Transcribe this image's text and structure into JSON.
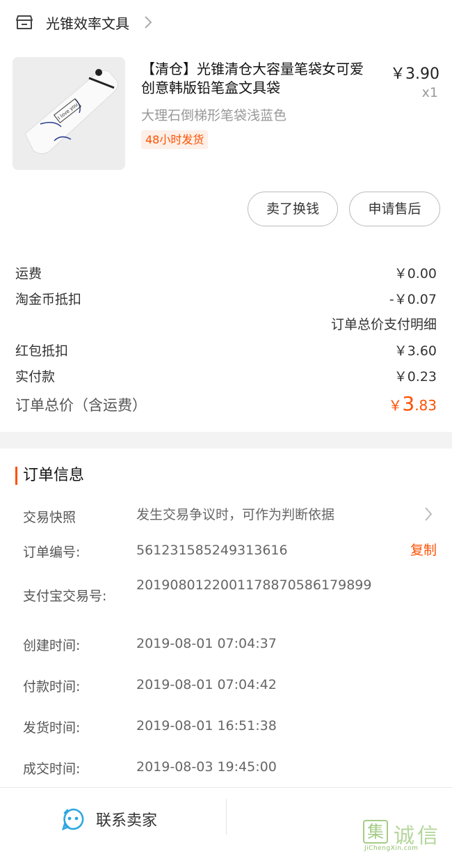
{
  "shop": {
    "name": "光锥效率文具"
  },
  "product": {
    "title": "【清仓】光锥清仓大容量笔袋女可爱创意韩版铅笔盒文具袋",
    "price": "￥3.90",
    "quantity": "x1",
    "sku": "大理石倒梯形笔袋浅蓝色",
    "ship_tag": "48小时发货",
    "image_text": "I love you"
  },
  "actions": {
    "sell_button": "卖了换钱",
    "after_sale_button": "申请售后"
  },
  "fees": {
    "shipping_label": "运费",
    "shipping_value": "￥0.00",
    "coin_label": "淘金币抵扣",
    "coin_value": "-￥0.07",
    "detail_link": "订单总价支付明细",
    "redpacket_label": "红包抵扣",
    "redpacket_value": "￥3.60",
    "paid_label": "实付款",
    "paid_value": "￥0.23",
    "total_label": "订单总价（含运费）",
    "total_currency": "￥",
    "total_int": "3",
    "total_dec": ".83"
  },
  "order_info": {
    "title": "订单信息",
    "snapshot_label": "交易快照",
    "snapshot_value": "发生交易争议时，可作为判断依据",
    "order_no_label": "订单编号:",
    "order_no_value": "561231585249313616",
    "copy_label": "复制",
    "alipay_label": "支付宝交易号:",
    "alipay_value": "2019080122001178870586179899",
    "created_label": "创建时间:",
    "created_value": "2019-08-01 07:04:37",
    "paid_label": "付款时间:",
    "paid_value": "2019-08-01 07:04:42",
    "shipped_label": "发货时间:",
    "shipped_value": "2019-08-01 16:51:38",
    "closed_label": "成交时间:",
    "closed_value": "2019-08-03 19:45:00"
  },
  "bottom": {
    "contact_label": "联系卖家"
  },
  "watermark": {
    "box_char": "集",
    "text": "诚信",
    "url": "JiChengXin.com"
  },
  "colors": {
    "accent": "#ff5000",
    "contact_icon": "#2da7e0"
  }
}
